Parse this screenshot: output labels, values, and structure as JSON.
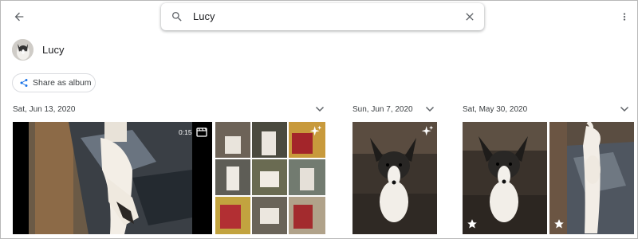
{
  "search": {
    "value": "Lucy"
  },
  "person": {
    "name": "Lucy"
  },
  "actions": {
    "share_label": "Share as album"
  },
  "groups": [
    {
      "date": "Sat, Jun 13, 2020"
    },
    {
      "date": "Sun, Jun 7, 2020"
    },
    {
      "date": "Sat, May 30, 2020"
    }
  ],
  "photos": [
    {
      "type": "video",
      "duration": "0:15"
    },
    {
      "type": "collage",
      "badge": "sparkle-icon"
    },
    {
      "type": "photo",
      "badge": "sparkle-icon"
    },
    {
      "type": "photo",
      "favorite": true
    },
    {
      "type": "photo",
      "favorite": true
    }
  ],
  "icons": [
    "back-arrow-icon",
    "search-icon",
    "clear-icon",
    "more-vert-icon",
    "share-icon",
    "chevron-down-icon",
    "video-icon",
    "sparkle-icon",
    "star-icon"
  ],
  "colors": {
    "accent": "#1a73e8",
    "text": "#202124",
    "secondary": "#3c4043",
    "border": "#dadce0"
  }
}
